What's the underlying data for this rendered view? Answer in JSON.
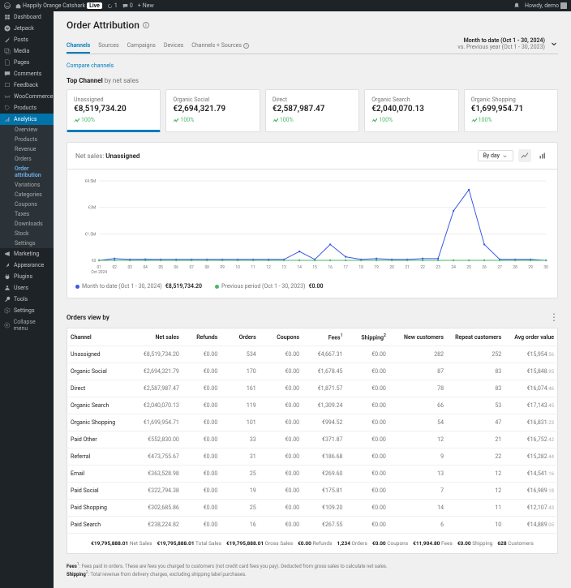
{
  "topbar": {
    "site": "Happily Orange Catshark",
    "live": "Live",
    "refresh": "0",
    "comments": "1",
    "updates": "0",
    "new": "New",
    "howdy": "Howdy, demo"
  },
  "sidebar": {
    "items": [
      {
        "label": "Dashboard"
      },
      {
        "label": "Jetpack"
      },
      {
        "label": "Posts"
      },
      {
        "label": "Media"
      },
      {
        "label": "Pages"
      },
      {
        "label": "Comments"
      },
      {
        "label": "Feedback"
      },
      {
        "label": "WooCommerce"
      },
      {
        "label": "Products"
      },
      {
        "label": "Analytics"
      },
      {
        "label": "Marketing"
      },
      {
        "label": "Appearance"
      },
      {
        "label": "Plugins"
      },
      {
        "label": "Users"
      },
      {
        "label": "Tools"
      },
      {
        "label": "Settings"
      }
    ],
    "sub": [
      "Overview",
      "Products",
      "Revenue",
      "Orders",
      "Order attribution",
      "Variations",
      "Categories",
      "Coupons",
      "Taxes",
      "Downloads",
      "Stock",
      "Settings"
    ],
    "collapse": "Collapse menu"
  },
  "page": {
    "title": "Order Attribution",
    "tabs": [
      "Channels",
      "Sources",
      "Campaigns",
      "Devices",
      "Channels + Sources"
    ],
    "compare": "Compare channels",
    "date_primary": "Month to date (Oct 1 - 30, 2024)",
    "date_secondary": "vs. Previous year (Oct 1 - 30, 2023)"
  },
  "topchannel": {
    "label": "Top Channel",
    "sub": "by net sales",
    "cards": [
      {
        "name": "Unassigned",
        "value": "€8,519,734.20",
        "trend": "100%"
      },
      {
        "name": "Organic Social",
        "value": "€2,694,321.79",
        "trend": "100%"
      },
      {
        "name": "Direct",
        "value": "€2,587,987.47",
        "trend": "100%"
      },
      {
        "name": "Organic Search",
        "value": "€2,040,070.13",
        "trend": "100%"
      },
      {
        "name": "Organic Shopping",
        "value": "€1,699,954.71",
        "trend": "100%"
      }
    ]
  },
  "chart_panel": {
    "label": "Net sales:",
    "selected": "Unassigned",
    "interval": "By day",
    "legend_current_label": "Month to date (Oct 1 - 30, 2024)",
    "legend_current_value": "€8,519,734.20",
    "legend_prev_label": "Previous period (Oct 1 - 30, 2023)",
    "legend_prev_value": "€0.00"
  },
  "chart_data": {
    "type": "line",
    "title": "Net sales: Unassigned",
    "xlabel": "Oct 2024",
    "ylabel": "",
    "ylim": [
      0,
      4500000
    ],
    "yticks": [
      "€0",
      "€1.5M",
      "€3M",
      "€4.5M"
    ],
    "categories": [
      "01",
      "02",
      "03",
      "04",
      "05",
      "06",
      "07",
      "08",
      "09",
      "10",
      "11",
      "12",
      "13",
      "14",
      "15",
      "16",
      "17",
      "18",
      "19",
      "20",
      "21",
      "22",
      "23",
      "24",
      "25",
      "26",
      "27",
      "28",
      "29",
      "30"
    ],
    "series": [
      {
        "name": "Month to date (Oct 1 - 30, 2024)",
        "color": "#3858e9",
        "values": [
          0,
          100000,
          50000,
          60000,
          50000,
          50000,
          50000,
          50000,
          50000,
          50000,
          50000,
          50000,
          50000,
          500000,
          50000,
          900000,
          200000,
          50000,
          100000,
          50000,
          50000,
          100000,
          100000,
          2800000,
          4000000,
          900000,
          50000,
          50000,
          50000,
          0
        ]
      },
      {
        "name": "Previous period (Oct 1 - 30, 2023)",
        "color": "#4ab866",
        "values": [
          0,
          0,
          0,
          0,
          0,
          0,
          0,
          0,
          0,
          0,
          0,
          0,
          0,
          0,
          0,
          0,
          0,
          0,
          0,
          0,
          0,
          0,
          0,
          0,
          0,
          0,
          0,
          0,
          0,
          0
        ]
      }
    ]
  },
  "ordersview": {
    "title": "Orders view by",
    "columns": [
      "Channel",
      "Net sales",
      "Refunds",
      "Orders",
      "Coupons",
      "Fees",
      "Shipping",
      "New customers",
      "Repeat customers",
      "Avg order value"
    ],
    "col_sup": {
      "5": "1",
      "6": "2"
    },
    "rows": [
      {
        "c": "Unassigned",
        "ns": "€8,519,734.20",
        "r": "€0.00",
        "o": "534",
        "cp": "€0.00",
        "f": "€4,667.31",
        "s": "€0.00",
        "nc": "282",
        "rc": "252",
        "av": "€15,954",
        "ac": ".56"
      },
      {
        "c": "Organic Social",
        "ns": "€2,694,321.79",
        "r": "€0.00",
        "o": "170",
        "cp": "€0.00",
        "f": "€1,678.45",
        "s": "€0.00",
        "nc": "87",
        "rc": "83",
        "av": "€15,848",
        "ac": ".95"
      },
      {
        "c": "Direct",
        "ns": "€2,587,987.47",
        "r": "€0.00",
        "o": "161",
        "cp": "€0.00",
        "f": "€1,871.57",
        "s": "€0.00",
        "nc": "78",
        "rc": "83",
        "av": "€16,074",
        "ac": ".46"
      },
      {
        "c": "Organic Search",
        "ns": "€2,040,070.13",
        "r": "€0.00",
        "o": "119",
        "cp": "€0.00",
        "f": "€1,309.24",
        "s": "€0.00",
        "nc": "66",
        "rc": "53",
        "av": "€17,143",
        "ac": ".45"
      },
      {
        "c": "Organic Shopping",
        "ns": "€1,699,954.71",
        "r": "€0.00",
        "o": "101",
        "cp": "€0.00",
        "f": "€994.52",
        "s": "€0.00",
        "nc": "54",
        "rc": "47",
        "av": "€16,831",
        "ac": ".23"
      },
      {
        "c": "Paid Other",
        "ns": "€552,830.00",
        "r": "€0.00",
        "o": "33",
        "cp": "€0.00",
        "f": "€371.87",
        "s": "€0.00",
        "nc": "12",
        "rc": "21",
        "av": "€16,752",
        "ac": ".42"
      },
      {
        "c": "Referral",
        "ns": "€473,755.67",
        "r": "€0.00",
        "o": "31",
        "cp": "€0.00",
        "f": "€186.68",
        "s": "€0.00",
        "nc": "9",
        "rc": "22",
        "av": "€15,282",
        "ac": ".44"
      },
      {
        "c": "Email",
        "ns": "€363,528.98",
        "r": "€0.00",
        "o": "25",
        "cp": "€0.00",
        "f": "€269.60",
        "s": "€0.00",
        "nc": "13",
        "rc": "12",
        "av": "€14,541",
        "ac": ".16"
      },
      {
        "c": "Paid Social",
        "ns": "€322,794.38",
        "r": "€0.00",
        "o": "19",
        "cp": "€0.00",
        "f": "€175.81",
        "s": "€0.00",
        "nc": "7",
        "rc": "12",
        "av": "€16,989",
        "ac": ".18"
      },
      {
        "c": "Paid Shopping",
        "ns": "€302,685.86",
        "r": "€0.00",
        "o": "25",
        "cp": "€0.00",
        "f": "€109.20",
        "s": "€0.00",
        "nc": "14",
        "rc": "11",
        "av": "€12,107",
        "ac": ".43"
      },
      {
        "c": "Paid Search",
        "ns": "€238,224.82",
        "r": "€0.00",
        "o": "16",
        "cp": "€0.00",
        "f": "€267.55",
        "s": "€0.00",
        "nc": "6",
        "rc": "10",
        "av": "€14,889",
        "ac": ".05"
      }
    ],
    "totals": [
      {
        "v": "€19,795,888.01",
        "l": "Net Sales"
      },
      {
        "v": "€19,795,888.01",
        "l": "Total Sales"
      },
      {
        "v": "€19,795,888.01",
        "l": "Gross Sales"
      },
      {
        "v": "€0.00",
        "l": "Refunds"
      },
      {
        "v": "1,234",
        "l": "Orders"
      },
      {
        "v": "€0.00",
        "l": "Coupons"
      },
      {
        "v": "€11,904.80",
        "l": "Fees"
      },
      {
        "v": "€0.00",
        "l": "Shipping"
      },
      {
        "v": "628",
        "l": "Customers"
      }
    ]
  },
  "footnotes": {
    "fees_label": "Fees",
    "fees_text": "Fees paid in orders. These are fees you charged to customers (not credit card fees you pay). Deducted from gross sales to calculate net sales.",
    "ship_label": "Shipping",
    "ship_text": "Total revenue from delivery charges, excluding shipping label purchases."
  }
}
